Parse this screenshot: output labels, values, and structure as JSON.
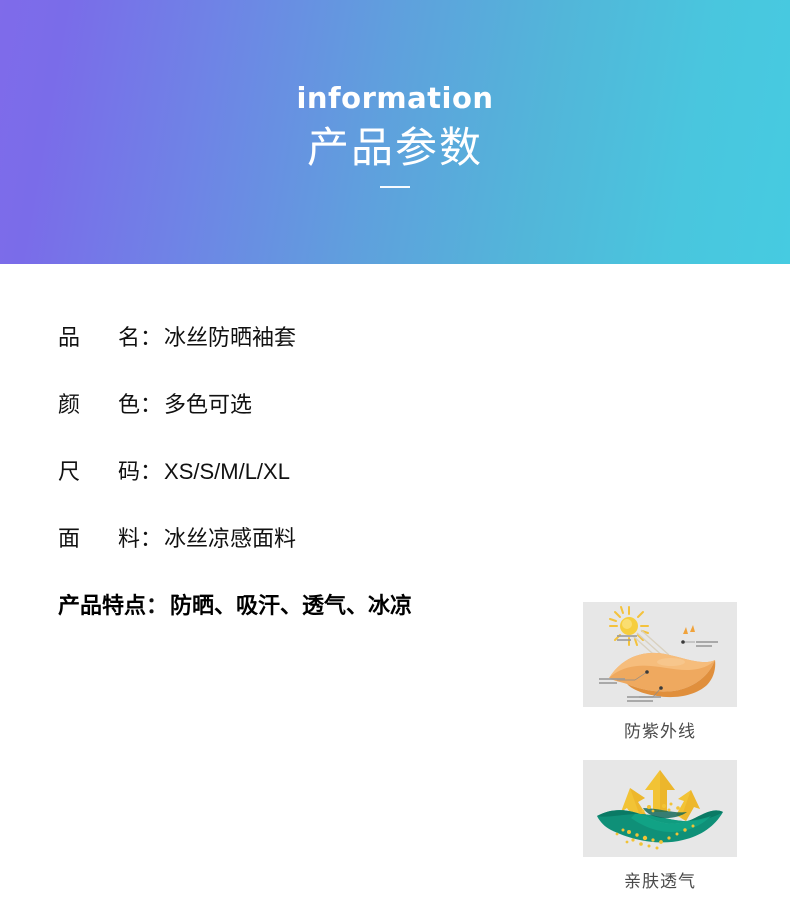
{
  "banner": {
    "eyebrow": "information",
    "title": "产品参数",
    "gradient_from": "#7f6bea",
    "gradient_to": "#46cbe1",
    "text_color": "#ffffff"
  },
  "specs": [
    {
      "label_chars": [
        "品",
        "名"
      ],
      "label_full": "品名",
      "colon": "：",
      "value": "冰丝防晒袖套"
    },
    {
      "label_chars": [
        "颜",
        "色"
      ],
      "label_full": "颜色",
      "colon": "：",
      "value": "多色可选"
    },
    {
      "label_chars": [
        "尺",
        "码"
      ],
      "label_full": "尺码",
      "colon": "：",
      "value": "XS/S/M/L/XL"
    },
    {
      "label_chars": [
        "面",
        "料"
      ],
      "label_full": "面料",
      "colon": "：",
      "value": "冰丝凉感面料"
    }
  ],
  "feature_row": {
    "label": "产品特点",
    "colon": "：",
    "value": "防晒、吸汗、透气、冰凉"
  },
  "cards": [
    {
      "icon": "uv-fabric-icon",
      "caption": "防紫外线",
      "fabric_color": "#eda45a",
      "accent_color": "#f6c242",
      "background": "#e7e7e7"
    },
    {
      "icon": "breathable-fabric-icon",
      "caption": "亲肤透气",
      "fabric_color": "#0f8d76",
      "accent_color": "#f2c335",
      "background": "#e7e7e7"
    }
  ]
}
